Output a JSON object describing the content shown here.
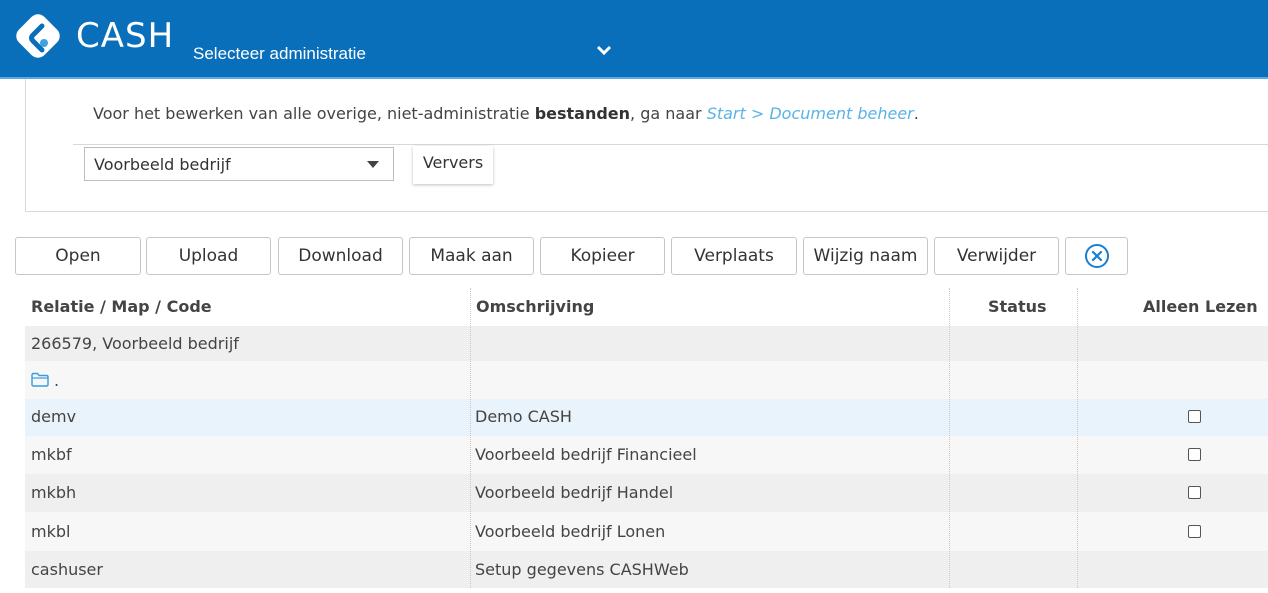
{
  "header": {
    "brand": "CASH",
    "admin_select_label": "Selecteer administratie",
    "colors": {
      "bar": "#0a6fba"
    },
    "logo_icon": "cash-logo-icon",
    "caret_icon": "chevron-down-icon"
  },
  "info": {
    "prefix": "Voor het bewerken van alle overige, niet-administratie ",
    "bold": "bestanden",
    "middle": ", ga naar ",
    "link": "Start > Document beheer",
    "suffix": "."
  },
  "company_select": {
    "value": "Voorbeeld bedrijf"
  },
  "refresh_label": "Ververs",
  "toolbar": {
    "buttons": [
      "Open",
      "Upload",
      "Download",
      "Maak aan",
      "Kopieer",
      "Verplaats",
      "Wijzig naam",
      "Verwijder"
    ],
    "clear_icon": "close-circle-icon"
  },
  "table": {
    "columns": [
      "Relatie / Map / Code",
      "Omschrijving",
      "Status",
      "Alleen Lezen"
    ],
    "rows": [
      {
        "code": "266579, Voorbeeld bedrijf",
        "description": "",
        "status": "",
        "readonly": null
      },
      {
        "code": ".",
        "description": "",
        "status": "",
        "readonly": null,
        "icon": "folder-icon"
      },
      {
        "code": "demv",
        "description": "Demo CASH",
        "status": "",
        "readonly": false
      },
      {
        "code": "mkbf",
        "description": "Voorbeeld bedrijf Financieel",
        "status": "",
        "readonly": false
      },
      {
        "code": "mkbh",
        "description": "Voorbeeld bedrijf Handel",
        "status": "",
        "readonly": false
      },
      {
        "code": "mkbl",
        "description": "Voorbeeld bedrijf Lonen",
        "status": "",
        "readonly": false
      },
      {
        "code": "cashuser",
        "description": "Setup gegevens CASHWeb",
        "status": "",
        "readonly": null
      }
    ]
  }
}
